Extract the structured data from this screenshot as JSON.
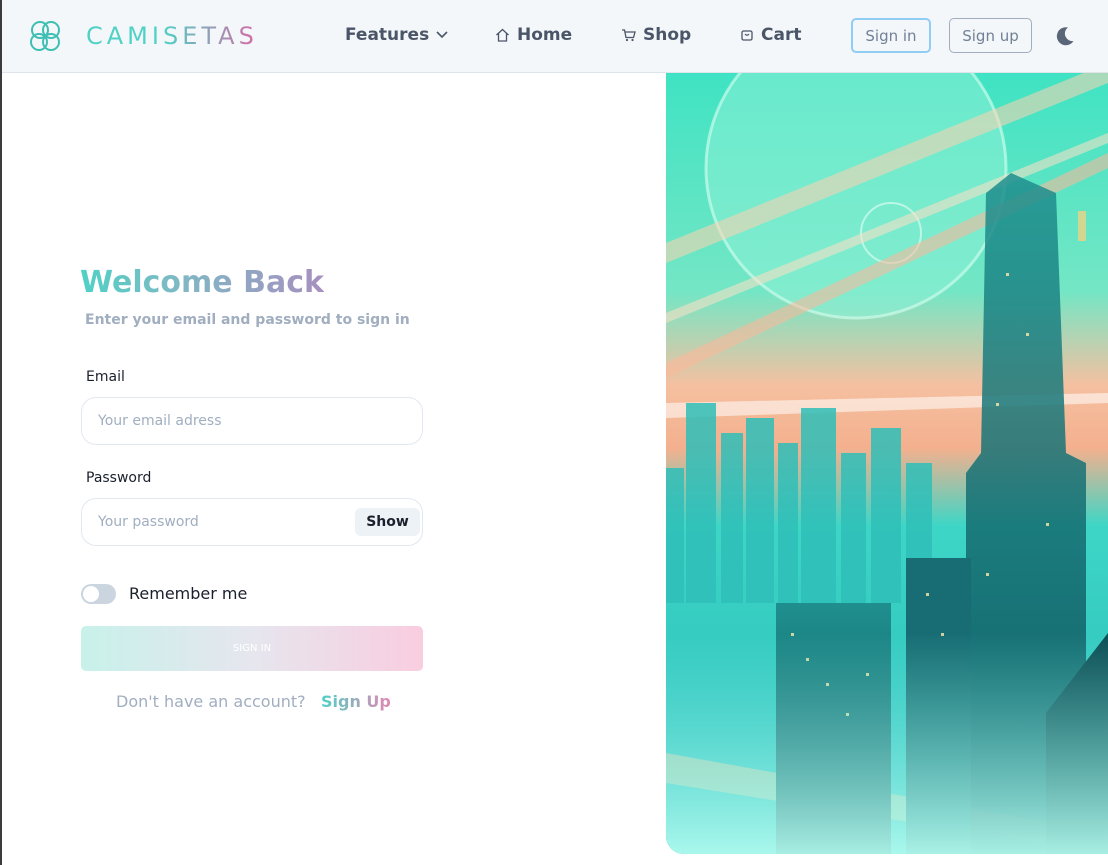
{
  "brand": {
    "name": "CAMISETAS",
    "logo_icon": "flower-logo-icon"
  },
  "nav": {
    "features_label": "Features",
    "home_label": "Home",
    "shop_label": "Shop",
    "cart_label": "Cart",
    "signin_label": "Sign in",
    "signup_label": "Sign up",
    "theme_icon": "moon-icon"
  },
  "login": {
    "title": "Welcome Back",
    "subtitle": "Enter your email and password to sign in",
    "email_label": "Email",
    "email_placeholder": "Your email adress",
    "email_value": "",
    "password_label": "Password",
    "password_placeholder": "Your password",
    "password_value": "",
    "show_label": "Show",
    "remember_label": "Remember me",
    "remember_checked": false,
    "submit_label": "SIGN IN",
    "footer_text": "Don't have an account?",
    "footer_link": "Sign Up"
  },
  "colors": {
    "teal": "#4fd1c5",
    "pink": "#d86aa6",
    "text_muted": "#a0aec0",
    "nav_bg": "#f4f7fa"
  }
}
